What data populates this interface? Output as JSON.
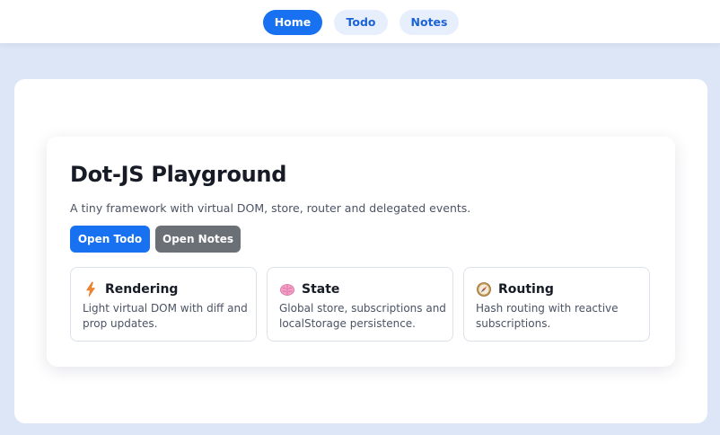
{
  "nav": {
    "items": [
      {
        "label": "Home",
        "active": true
      },
      {
        "label": "Todo",
        "active": false
      },
      {
        "label": "Notes",
        "active": false
      }
    ]
  },
  "hero": {
    "title": "Dot-JS Playground",
    "subtitle": "A tiny framework with virtual DOM, store, router and delegated events.",
    "buttons": {
      "open_todo": "Open Todo",
      "open_notes": "Open Notes"
    }
  },
  "features": [
    {
      "icon": "lightning-icon",
      "title": "Rendering",
      "description": "Light virtual DOM with diff and prop updates."
    },
    {
      "icon": "brain-icon",
      "title": "State",
      "description": "Global store, subscriptions and localStorage persistence."
    },
    {
      "icon": "compass-icon",
      "title": "Routing",
      "description": "Hash routing with reactive subscriptions."
    }
  ],
  "colors": {
    "accent": "#1771f1",
    "secondary_button": "#6b6f76",
    "page_background": "#dde6f6",
    "nav_pill_inactive": "#e8effc"
  }
}
